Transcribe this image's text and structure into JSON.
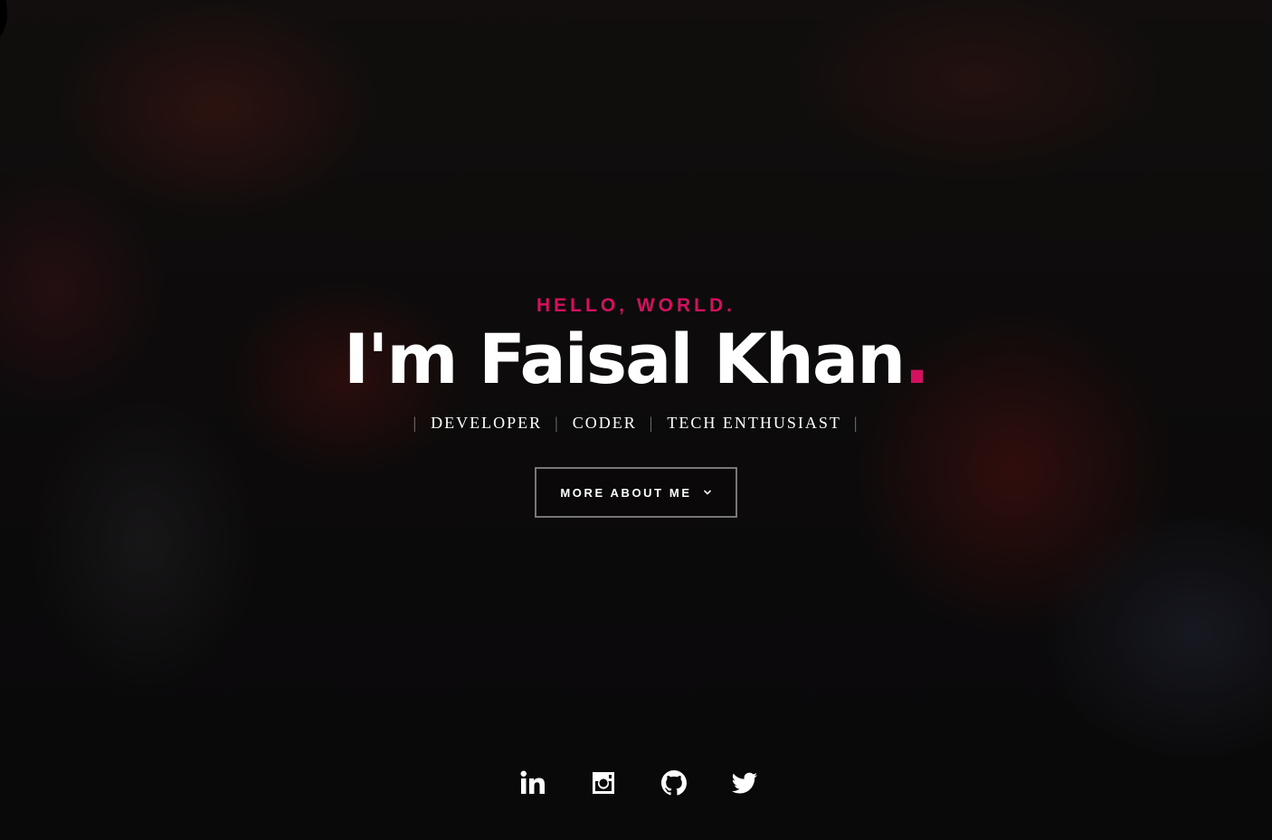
{
  "intro": {
    "kicker": "HELLO, WORLD.",
    "name": "I'm Faisal Khan",
    "name_suffix": ".",
    "roles": [
      "DEVELOPER",
      "CODER",
      "TECH ENTHUSIAST"
    ],
    "separator": "|"
  },
  "cta": {
    "label": "MORE ABOUT ME"
  },
  "social": [
    {
      "icon": "linkedin-icon"
    },
    {
      "icon": "instagram-icon"
    },
    {
      "icon": "github-icon"
    },
    {
      "icon": "twitter-icon"
    }
  ],
  "colors": {
    "accent": "#d4115e",
    "text": "#ffffff",
    "background": "#141112"
  }
}
